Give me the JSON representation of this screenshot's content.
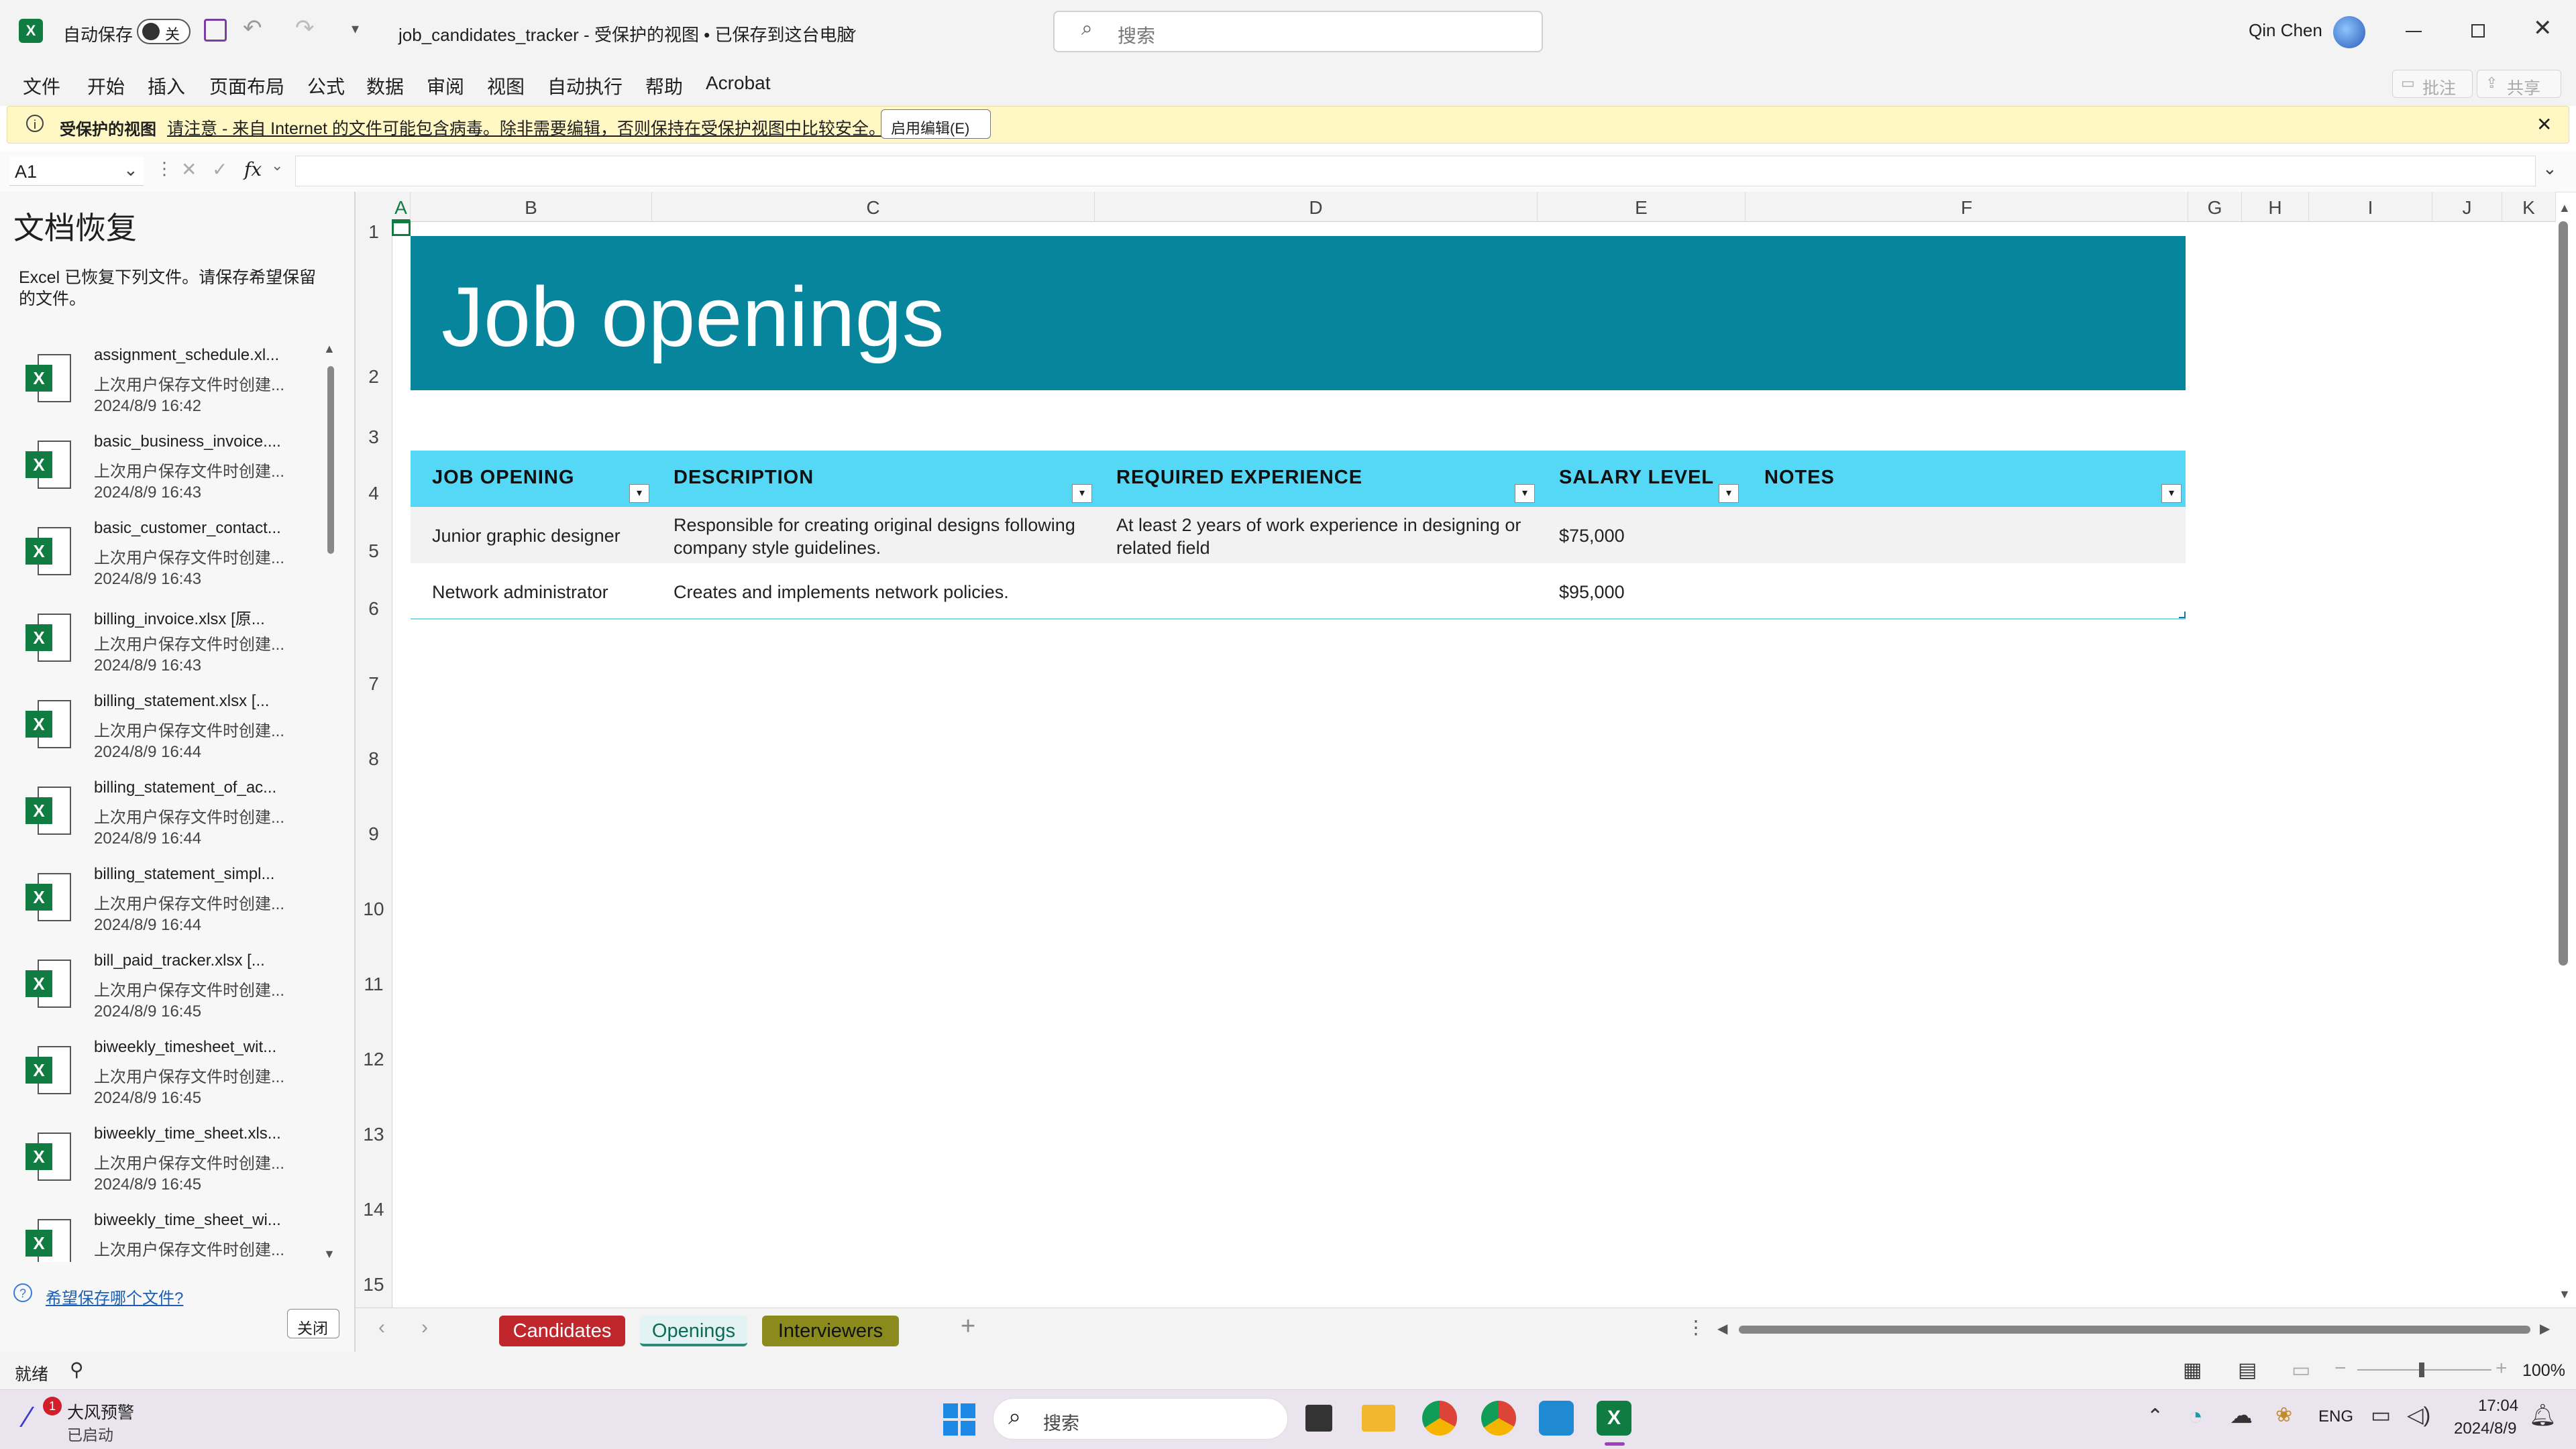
{
  "app": {
    "autosave_label": "自动保存",
    "autosave_state": "关",
    "file_title": "job_candidates_tracker  -  受保护的视图 • 已保存到这台电脑",
    "search_placeholder": "搜索",
    "user_name": "Qin Chen"
  },
  "ribbon": {
    "tabs": [
      "文件",
      "开始",
      "插入",
      "页面布局",
      "公式",
      "数据",
      "审阅",
      "视图",
      "自动执行",
      "帮助",
      "Acrobat"
    ],
    "comment_label": "批注",
    "share_label": "共享"
  },
  "protected_view": {
    "title": "受保护的视图",
    "message": "请注意 - 来自 Internet 的文件可能包含病毒。除非需要编辑，否则保持在受保护视图中比较安全。",
    "enable_button": "启用编辑(E)"
  },
  "formula_bar": {
    "name_box": "A1",
    "fx_label": "fx",
    "content": ""
  },
  "recovery": {
    "title": "文档恢复",
    "subtitle": "Excel 已恢复下列文件。请保存希望保留的文件。",
    "files": [
      {
        "name": "assignment_schedule.xl...",
        "desc": "上次用户保存文件时创建...",
        "date": "2024/8/9 16:42"
      },
      {
        "name": "basic_business_invoice....",
        "desc": "上次用户保存文件时创建...",
        "date": "2024/8/9 16:43"
      },
      {
        "name": "basic_customer_contact...",
        "desc": "上次用户保存文件时创建...",
        "date": "2024/8/9 16:43"
      },
      {
        "name": "billing_invoice.xlsx  [原...",
        "desc": "上次用户保存文件时创建...",
        "date": "2024/8/9 16:43"
      },
      {
        "name": "billing_statement.xlsx  [...",
        "desc": "上次用户保存文件时创建...",
        "date": "2024/8/9 16:44"
      },
      {
        "name": "billing_statement_of_ac...",
        "desc": "上次用户保存文件时创建...",
        "date": "2024/8/9 16:44"
      },
      {
        "name": "billing_statement_simpl...",
        "desc": "上次用户保存文件时创建...",
        "date": "2024/8/9 16:44"
      },
      {
        "name": "bill_paid_tracker.xlsx  [...",
        "desc": "上次用户保存文件时创建...",
        "date": "2024/8/9 16:45"
      },
      {
        "name": "biweekly_timesheet_wit...",
        "desc": "上次用户保存文件时创建...",
        "date": "2024/8/9 16:45"
      },
      {
        "name": "biweekly_time_sheet.xls...",
        "desc": "上次用户保存文件时创建...",
        "date": "2024/8/9 16:45"
      },
      {
        "name": "biweekly_time_sheet_wi...",
        "desc": "上次用户保存文件时创建...",
        "date": ""
      }
    ],
    "help_link": "希望保存哪个文件?",
    "close_button": "关闭"
  },
  "sheet": {
    "columns": [
      "A",
      "B",
      "C",
      "D",
      "E",
      "F",
      "G",
      "H",
      "I",
      "J",
      "K"
    ],
    "rows": [
      "1",
      "2",
      "3",
      "4",
      "5",
      "6",
      "7",
      "8",
      "9",
      "10",
      "11",
      "12",
      "13",
      "14",
      "15"
    ],
    "banner_title": "Job openings",
    "headers": [
      "JOB OPENING",
      "DESCRIPTION",
      "REQUIRED EXPERIENCE",
      "SALARY LEVEL",
      "NOTES"
    ],
    "data_rows": [
      {
        "job": "Junior graphic designer",
        "desc1": "Responsible for creating original designs following",
        "desc2": "company style guidelines.",
        "exp1": "At least 2 years of work experience in designing or",
        "exp2": "related field",
        "salary": "$75,000",
        "notes": ""
      },
      {
        "job": "Network administrator",
        "desc1": "Creates and implements network policies.",
        "desc2": "",
        "exp1": "",
        "exp2": "",
        "salary": "$95,000",
        "notes": ""
      }
    ]
  },
  "sheet_tabs": [
    {
      "label": "Candidates",
      "color": "#c0272d"
    },
    {
      "label": "Openings",
      "color": "#e8f4f4"
    },
    {
      "label": "Interviewers",
      "color": "#8a8b1c"
    }
  ],
  "status": {
    "ready": "就绪",
    "zoom": "100%"
  },
  "taskbar": {
    "weather_title": "大风预警",
    "weather_sub": "已启动",
    "weather_badge": "1",
    "search_placeholder": "搜索",
    "lang": "ENG",
    "time": "17:04",
    "date": "2024/8/9"
  },
  "colors": {
    "excel_green": "#107c41",
    "banner": "#07859c",
    "header_band": "#54d8f5"
  }
}
